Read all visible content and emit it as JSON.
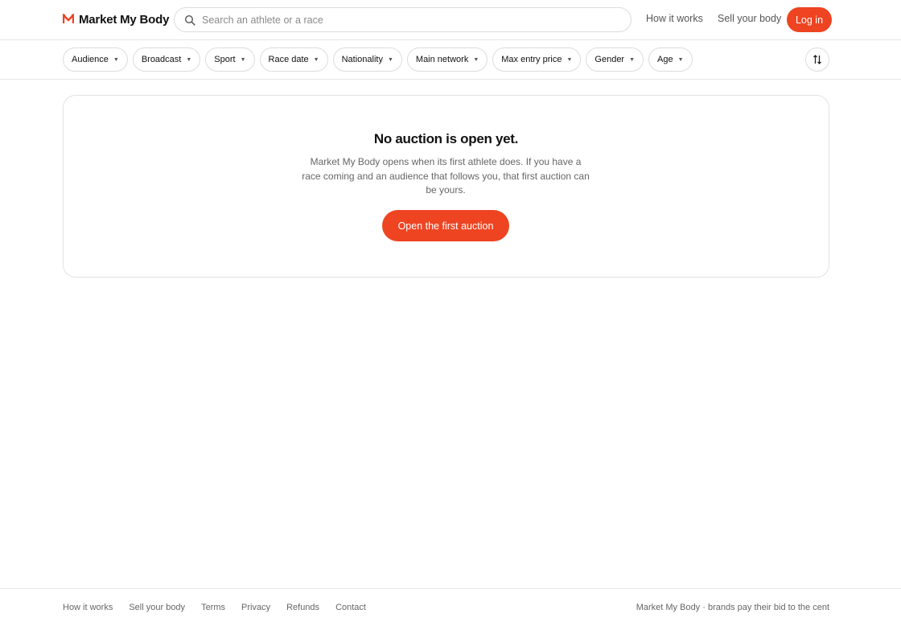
{
  "brand": {
    "name": "Market My Body",
    "accent_color": "#ee4422",
    "logo_icon": "m-logo-icon"
  },
  "search": {
    "placeholder": "Search an athlete or a race",
    "icon": "search-icon"
  },
  "nav": {
    "how_it_works": "How it works",
    "sell_your_body": "Sell your body",
    "login": "Log in"
  },
  "filters": [
    {
      "label": "Audience"
    },
    {
      "label": "Broadcast"
    },
    {
      "label": "Sport"
    },
    {
      "label": "Race date"
    },
    {
      "label": "Nationality"
    },
    {
      "label": "Main network"
    },
    {
      "label": "Max entry price"
    },
    {
      "label": "Gender"
    },
    {
      "label": "Age"
    }
  ],
  "sort": {
    "icon": "sort-arrows-icon"
  },
  "empty_state": {
    "title": "No auction is open yet.",
    "body": "Market My Body opens when its first athlete does. If you have a race coming and an audience that follows you, that first auction can be yours.",
    "cta": "Open the first auction"
  },
  "footer": {
    "links": [
      "How it works",
      "Sell your body",
      "Terms",
      "Privacy",
      "Refunds",
      "Contact"
    ],
    "tagline": "Market My Body · brands pay their bid to the cent"
  }
}
